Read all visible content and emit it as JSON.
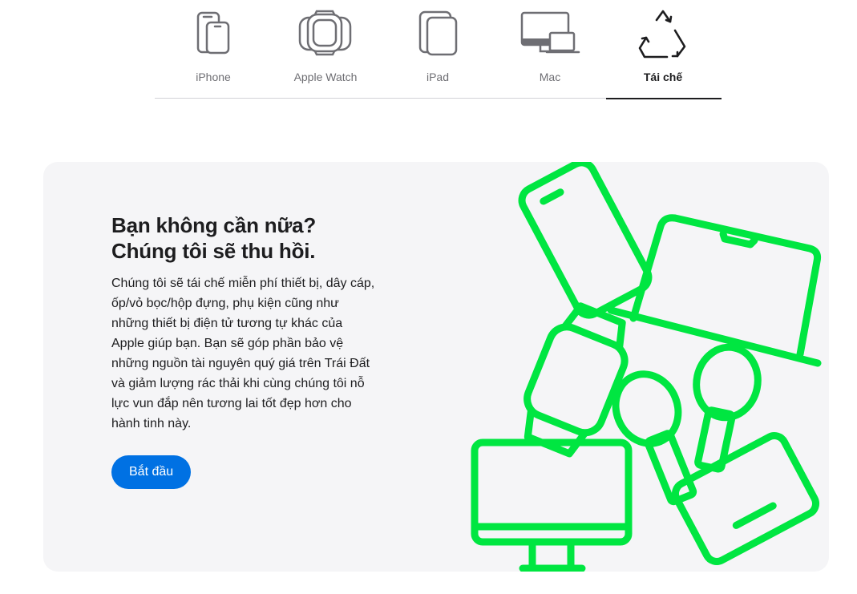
{
  "tabs": [
    {
      "label": "iPhone",
      "icon": "iphone-icon"
    },
    {
      "label": "Apple Watch",
      "icon": "apple-watch-icon"
    },
    {
      "label": "iPad",
      "icon": "ipad-icon"
    },
    {
      "label": "Mac",
      "icon": "mac-icon"
    },
    {
      "label": "Tái chế",
      "icon": "recycle-icon",
      "active": true
    }
  ],
  "promo": {
    "headline_line1": "Bạn không cần nữa?",
    "headline_line2": "Chúng tôi sẽ thu hồi.",
    "body": "Chúng tôi sẽ tái chế miễn phí thiết bị, dây cáp, ốp/vỏ bọc/hộp đựng, phụ kiện cũng như những thiết bị điện tử tương tự khác của Apple giúp bạn. Bạn sẽ góp phần bảo vệ những nguồn tài nguyên quý giá trên Trái Đất và giảm lượng rác thải khi cùng chúng tôi nỗ lực vun đắp nên tương lai tốt đẹp hơn cho hành tinh này.",
    "cta_label": "Bắt đầu"
  },
  "colors": {
    "accent_blue": "#0071e3",
    "illustration_green": "#00e641",
    "card_background": "#f5f5f7"
  }
}
